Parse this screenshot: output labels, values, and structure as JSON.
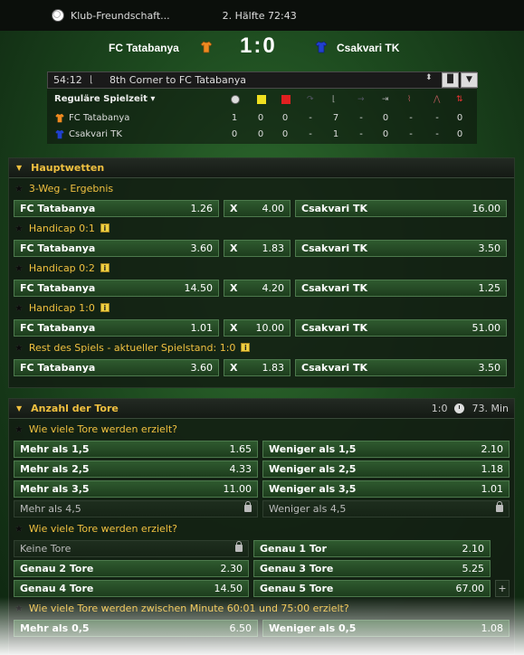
{
  "header": {
    "title": "Klub-Freundschaft...",
    "status": "2. Hälfte 72:43"
  },
  "scoreboard": {
    "home": "FC Tatabanya",
    "away": "Csakvari TK",
    "score": "1:0",
    "home_color": "#f08a20",
    "away_color": "#2040d0"
  },
  "live": {
    "time": "54:12",
    "event": "8th Corner to FC Tatabanya",
    "period_label": "Reguläre Spielzeit",
    "stat_icons": [
      "ball-icon",
      "yellow-card-icon",
      "red-card-icon",
      "substitution-icon",
      "corner-icon",
      "free-kick-icon",
      "goal-kick-icon",
      "throw-in-icon",
      "offside-icon",
      "substitution-arrows-icon"
    ],
    "rows": [
      {
        "team": "FC Tatabanya",
        "values": [
          "1",
          "0",
          "0",
          "-",
          "7",
          "-",
          "0",
          "-",
          "-",
          "0"
        ]
      },
      {
        "team": "Csakvari TK",
        "values": [
          "0",
          "0",
          "0",
          "-",
          "1",
          "-",
          "0",
          "-",
          "-",
          "0"
        ]
      }
    ]
  },
  "main_bets": {
    "title": "Hauptwetten",
    "markets": [
      {
        "name": "3-Weg - Ergebnis",
        "info": false,
        "home": "FC Tatabanya",
        "home_odd": "1.26",
        "draw": "X",
        "draw_odd": "4.00",
        "away": "Csakvari TK",
        "away_odd": "16.00"
      },
      {
        "name": "Handicap 0:1",
        "info": true,
        "home": "FC Tatabanya",
        "home_odd": "3.60",
        "draw": "X",
        "draw_odd": "1.83",
        "away": "Csakvari TK",
        "away_odd": "3.50"
      },
      {
        "name": "Handicap 0:2",
        "info": true,
        "home": "FC Tatabanya",
        "home_odd": "14.50",
        "draw": "X",
        "draw_odd": "4.20",
        "away": "Csakvari TK",
        "away_odd": "1.25"
      },
      {
        "name": "Handicap 1:0",
        "info": true,
        "home": "FC Tatabanya",
        "home_odd": "1.01",
        "draw": "X",
        "draw_odd": "10.00",
        "away": "Csakvari TK",
        "away_odd": "51.00"
      },
      {
        "name": "Rest des Spiels - aktueller Spielstand: 1:0",
        "info": true,
        "home": "FC Tatabanya",
        "home_odd": "3.60",
        "draw": "X",
        "draw_odd": "1.83",
        "away": "Csakvari TK",
        "away_odd": "3.50"
      }
    ]
  },
  "goals": {
    "title": "Anzahl der Tore",
    "score": "1:0",
    "minute": "73. Min",
    "market1": {
      "name": "Wie viele Tore werden erzielt?",
      "rows": [
        {
          "l": "Mehr als 1,5",
          "lv": "1.65",
          "r": "Weniger als 1,5",
          "rv": "2.10"
        },
        {
          "l": "Mehr als 2,5",
          "lv": "4.33",
          "r": "Weniger als 2,5",
          "rv": "1.18"
        },
        {
          "l": "Mehr als 3,5",
          "lv": "11.00",
          "r": "Weniger als 3,5",
          "rv": "1.01"
        },
        {
          "l": "Mehr als 4,5",
          "lv": "",
          "r": "Weniger als 4,5",
          "rv": ""
        }
      ]
    },
    "market2": {
      "name": "Wie viele Tore werden erzielt?",
      "rows": [
        {
          "l": "Keine Tore",
          "lv": "",
          "r": "Genau 1 Tor",
          "rv": "2.10"
        },
        {
          "l": "Genau 2 Tore",
          "lv": "2.30",
          "r": "Genau 3 Tore",
          "rv": "5.25"
        },
        {
          "l": "Genau 4 Tore",
          "lv": "14.50",
          "r": "Genau 5 Tore",
          "rv": "67.00"
        }
      ],
      "plus": "+"
    },
    "market3": {
      "name": "Wie viele Tore werden zwischen Minute 60:01 und 75:00 erzielt?",
      "row": {
        "l": "Mehr als 0,5",
        "lv": "6.50",
        "r": "Weniger als 0,5",
        "rv": "1.08"
      }
    }
  }
}
